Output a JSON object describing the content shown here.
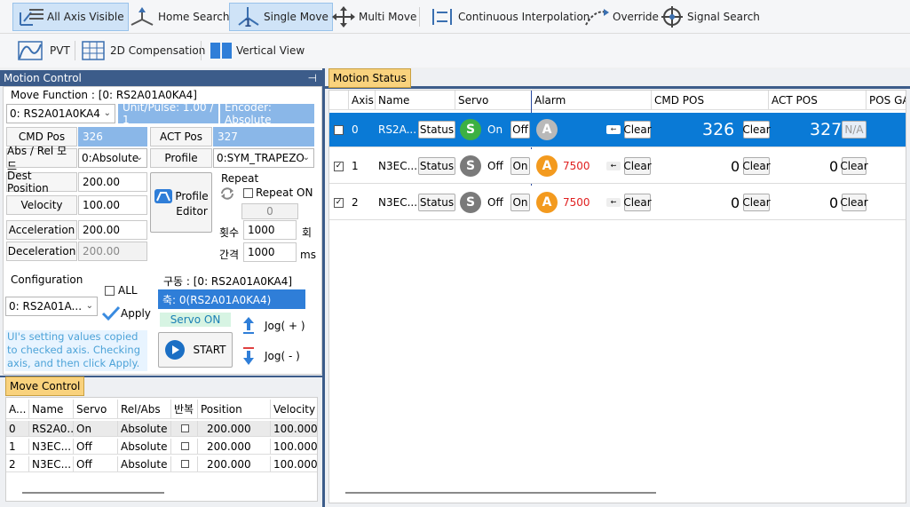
{
  "toolbar1": {
    "all_axis": "All Axis Visible",
    "home": "Home Search",
    "single": "Single Move",
    "multi": "Multi Move",
    "interp": "Continuous Interpolation",
    "override": "Override",
    "signal": "Signal Search"
  },
  "toolbar2": {
    "pvt": "PVT",
    "comp": "2D Compensation",
    "vert": "Vertical View"
  },
  "motion_control": {
    "title": "Motion Control",
    "pin": "⊣",
    "move_function": "Move Function : [0: RS2A01A0KA4]",
    "axis_sel": "0: RS2A01A0KA4",
    "unit": "Unit/Pulse: 1.00 / 1",
    "encoder": "Encoder: Absolute",
    "cmd_pos_label": "CMD Pos",
    "cmd_pos": "326",
    "act_pos_label": "ACT Pos",
    "act_pos": "327",
    "absrel_label": "Abs / Rel 모드",
    "absrel": "0:Absolute",
    "profile_label": "Profile",
    "profile": "0:SYM_TRAPEZO",
    "dest_label": "Dest Position",
    "dest": "200.00",
    "vel_label": "Velocity",
    "vel": "100.00",
    "acc_label": "Acceleration",
    "acc": "200.00",
    "dec_label": "Deceleration",
    "dec": "200.00",
    "profile_editor": "Profile\nEditor",
    "profile_editor_1": "Profile",
    "profile_editor_2": "Editor",
    "repeat": "Repeat",
    "repeat_on": "Repeat ON",
    "repeat_count": "0",
    "times_label": "횟수",
    "times": "1000",
    "times_unit": "회",
    "interval_label": "간격",
    "interval": "1000",
    "interval_unit": "ms",
    "config": "Configuration",
    "all": "ALL",
    "config_axis": "0: RS2A01A...",
    "apply": "Apply",
    "note": "UI's setting values copied to checked axis. Checking axis, and then click Apply.",
    "drive": "구동 : [0: RS2A01A0KA4]",
    "drive_axis": "축: 0(RS2A01A0KA4)",
    "servo_on": "Servo ON",
    "start": "START",
    "jog_plus": "Jog( + )",
    "jog_minus": "Jog( - )"
  },
  "move_control": {
    "tab": "Move Control",
    "headers": [
      "A...",
      "Name",
      "Servo",
      "Rel/Abs",
      "반복",
      "Position",
      "Velocity"
    ],
    "rows": [
      [
        "0",
        "RS2A0...",
        "On",
        "Absolute",
        "",
        "200.000",
        "100.000"
      ],
      [
        "1",
        "N3EC...",
        "Off",
        "Absolute",
        "",
        "200.000",
        "100.000"
      ],
      [
        "2",
        "N3EC...",
        "Off",
        "Absolute",
        "",
        "200.000",
        "100.000"
      ]
    ]
  },
  "motion_status": {
    "tab": "Motion Status",
    "headers": [
      "Axis",
      "Name",
      "Servo",
      "Alarm",
      "CMD POS",
      "ACT POS",
      "POS GA"
    ],
    "rows": [
      {
        "axis": "0",
        "name": "RS2A...",
        "status": "Status",
        "servo": "On",
        "servo_btn": "Off",
        "alarm": "",
        "clear": "Clear",
        "cmd": "326",
        "act": "327",
        "na": "N/A"
      },
      {
        "axis": "1",
        "name": "N3EC...",
        "status": "Status",
        "servo": "Off",
        "servo_btn": "On",
        "alarm": "7500",
        "clear": "Clear",
        "cmd": "0",
        "act": "0",
        "na": "Clear"
      },
      {
        "axis": "2",
        "name": "N3EC...",
        "status": "Status",
        "servo": "Off",
        "servo_btn": "On",
        "alarm": "7500",
        "clear": "Clear",
        "cmd": "0",
        "act": "0",
        "na": "Clear"
      }
    ]
  },
  "colors": {
    "accent": "#0a7ad6",
    "panel_title": "#3c5c8a",
    "tab": "#f9d27d",
    "servo_on": "#3cb043",
    "servo_off": "#7a7a7a",
    "alarm": "#f39a1e",
    "alarm_idle": "#b9b9b9"
  }
}
